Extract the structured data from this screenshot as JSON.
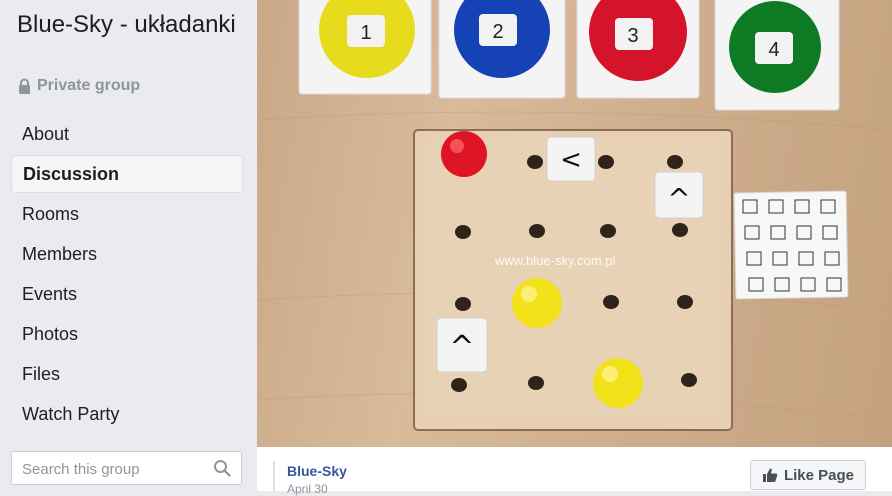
{
  "group": {
    "title": "Blue-Sky - układanki",
    "privacy": "Private group",
    "lock_icon": "lock-icon"
  },
  "nav": {
    "items": [
      {
        "label": "About",
        "active": false
      },
      {
        "label": "Discussion",
        "active": true
      },
      {
        "label": "Rooms",
        "active": false
      },
      {
        "label": "Members",
        "active": false
      },
      {
        "label": "Events",
        "active": false
      },
      {
        "label": "Photos",
        "active": false
      },
      {
        "label": "Files",
        "active": false
      },
      {
        "label": "Watch Party",
        "active": false
      }
    ]
  },
  "search": {
    "placeholder": "Search this group",
    "icon": "search-icon"
  },
  "photo": {
    "cards": [
      "1",
      "2",
      "3",
      "4"
    ],
    "card_colors": [
      "#e7dc1c",
      "#1543b6",
      "#d4142a",
      "#0f7a24"
    ],
    "tiles": [
      "<",
      "^",
      "^"
    ],
    "watermark": "www.blue-sky.com.pl"
  },
  "post": {
    "author": "Blue-Sky",
    "date": "April 30",
    "like_button": "Like Page",
    "like_icon": "thumbs-up-icon"
  }
}
